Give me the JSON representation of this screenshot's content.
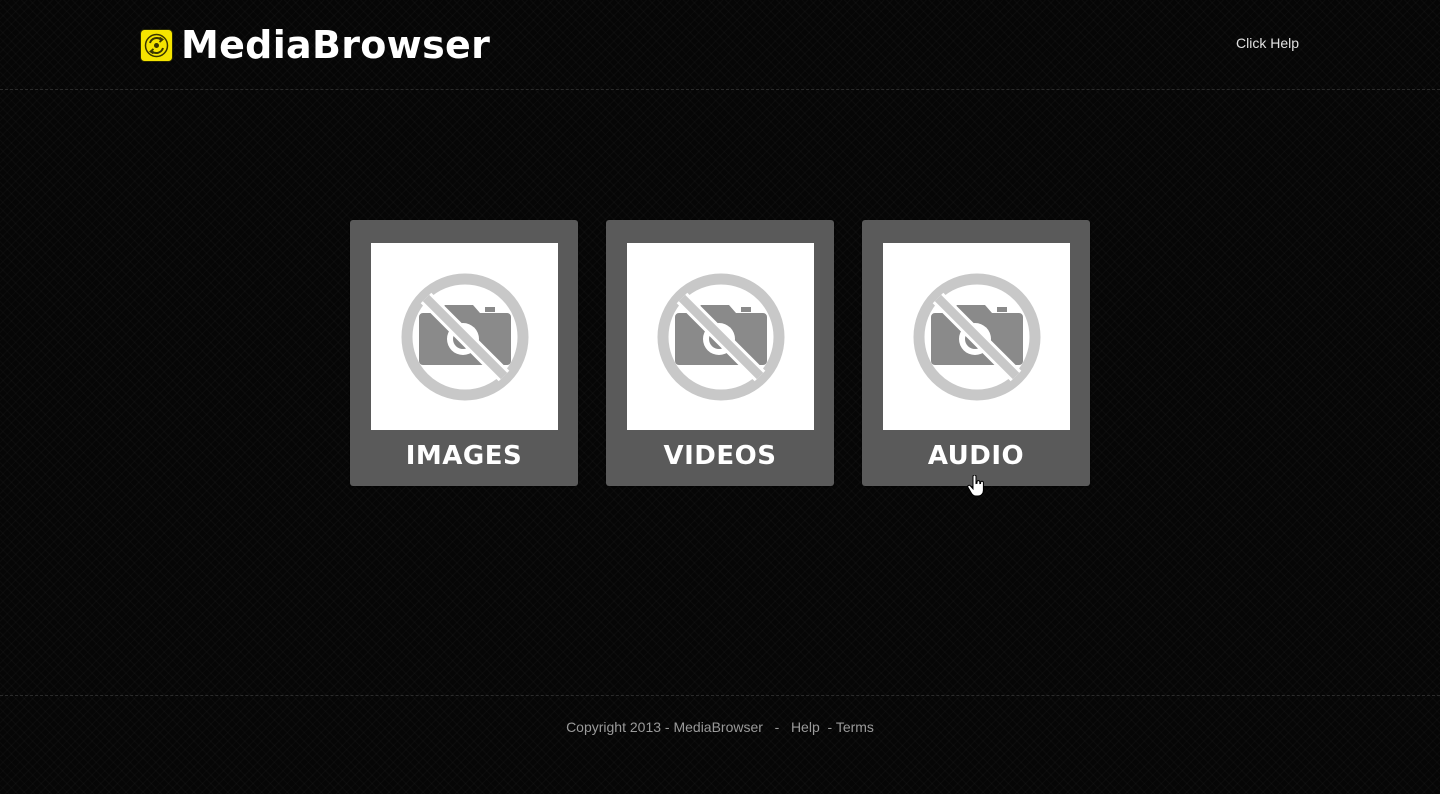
{
  "header": {
    "logo_text": "MediaBrowser",
    "logo_icon": "recycle-badge-icon",
    "help_label": "Click Help"
  },
  "tiles": [
    {
      "label": "IMAGES",
      "icon": "no-camera-icon"
    },
    {
      "label": "VIDEOS",
      "icon": "no-camera-icon"
    },
    {
      "label": "AUDIO",
      "icon": "no-camera-icon"
    }
  ],
  "footer": {
    "copyright": "Copyright 2013 - MediaBrowser",
    "separator_1": "   -   ",
    "help_link": "Help",
    "separator_2": "  - ",
    "terms_link": "Terms"
  },
  "colors": {
    "background": "#060606",
    "tile": "#5a5a5a",
    "logo_accent": "#f5e400",
    "placeholder_gray": "#c8c8c8",
    "camera_gray": "#8a8a8a"
  }
}
